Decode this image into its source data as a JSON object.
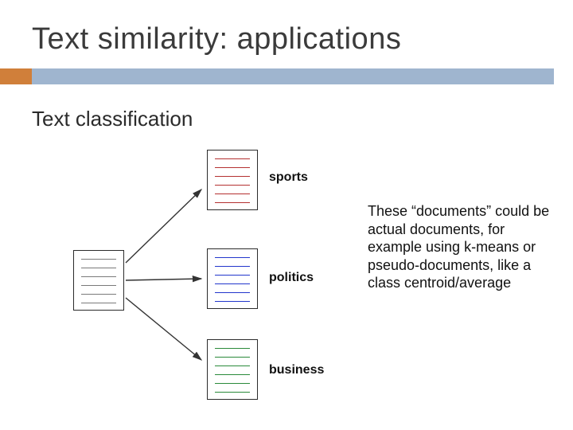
{
  "title": "Text similarity: applications",
  "subtitle": "Text classification",
  "categories": {
    "sports": {
      "label": "sports",
      "color": "#b43030"
    },
    "politics": {
      "label": "politics",
      "color": "#2236cc"
    },
    "business": {
      "label": "business",
      "color": "#2a8a3a"
    }
  },
  "source_doc_color": "#7a7a7a",
  "note": "These “documents” could be actual documents, for example using k-means or pseudo-documents, like a class centroid/average",
  "accent_color": "#d07f3a",
  "bar_color": "#9fb5cf"
}
